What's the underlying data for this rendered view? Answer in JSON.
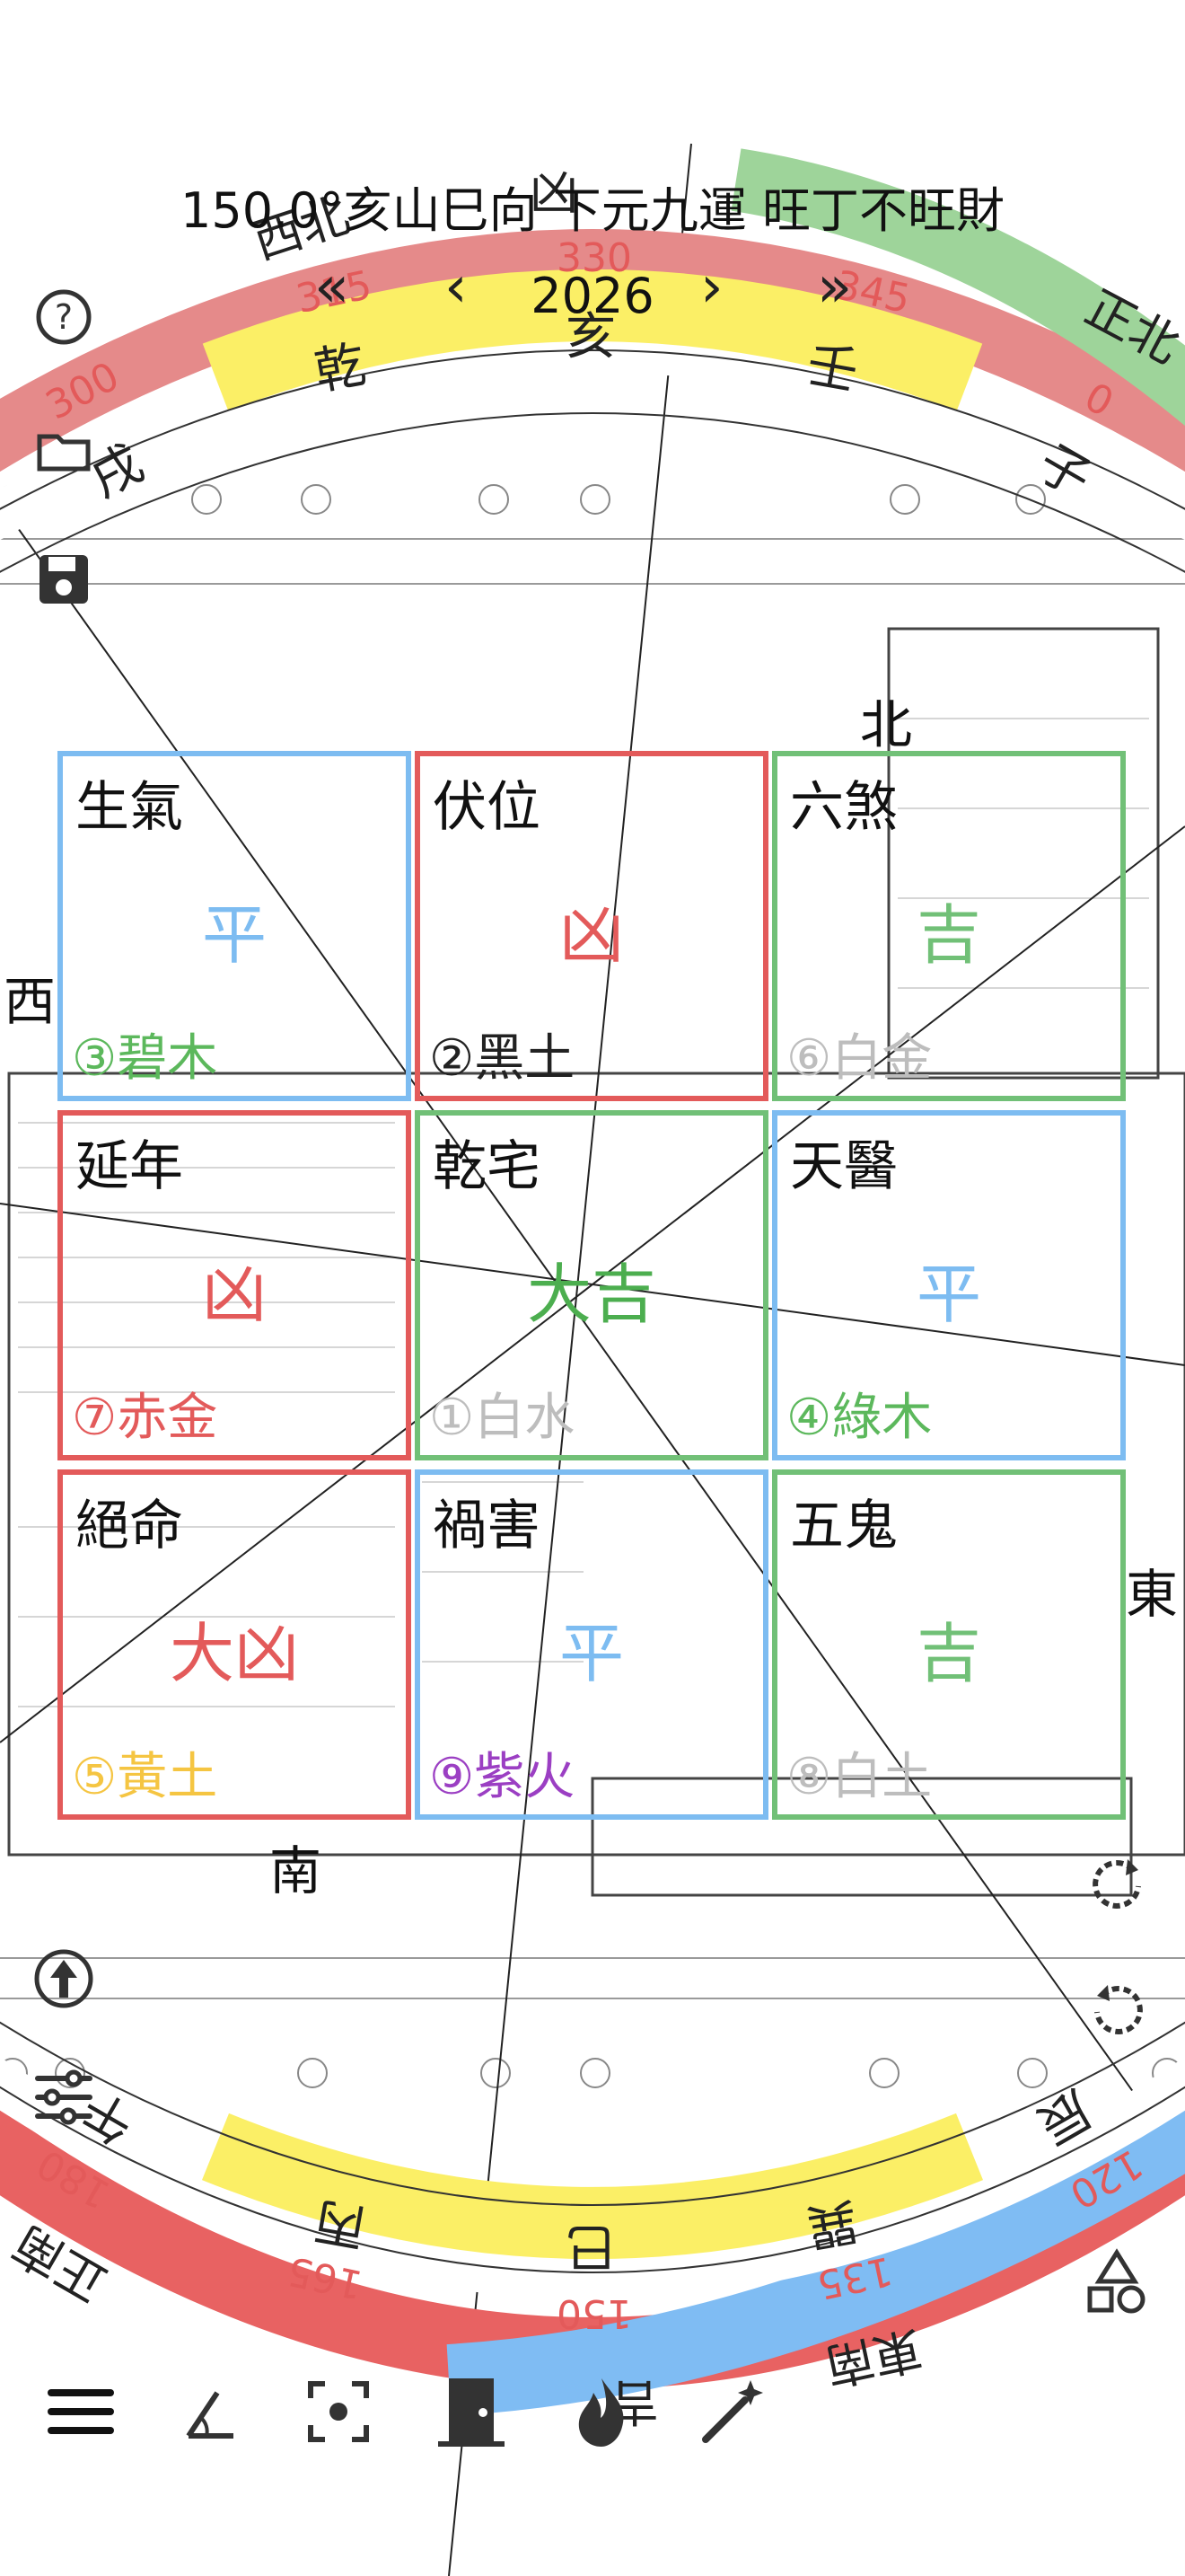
{
  "header": {
    "title": "150.0°亥山巳向 下元九運 旺丁不旺財",
    "year": "2026",
    "nav": {
      "prev_fast": "«",
      "prev": "‹",
      "next": "›",
      "next_fast": "»"
    }
  },
  "compass_top": {
    "mountains_outer": [
      "西北",
      "正北"
    ],
    "degrees": [
      "315",
      "330",
      "345",
      "300",
      "0"
    ],
    "inner": [
      "乾",
      "亥",
      "壬",
      "戌",
      "子"
    ],
    "marker": "凶"
  },
  "compass_bottom": {
    "mountains_outer": [
      "正南",
      "東南"
    ],
    "degrees": [
      "180",
      "165",
      "150",
      "135",
      "120"
    ],
    "inner": [
      "丙",
      "巳",
      "巽",
      "午",
      "辰"
    ],
    "marker": "吉"
  },
  "directions": {
    "north": "北",
    "west": "西",
    "east": "東",
    "south": "南"
  },
  "grid": [
    {
      "name": "生氣",
      "rating": "平",
      "star": "③碧木",
      "star_color": "#5cb85c",
      "rating_color": "#7dbcf1",
      "border": "blue"
    },
    {
      "name": "伏位",
      "rating": "凶",
      "star": "②黑土",
      "star_color": "#222222",
      "rating_color": "#e35a5a",
      "border": "red"
    },
    {
      "name": "六煞",
      "rating": "吉",
      "star": "⑥白金",
      "star_color": "#bdbdbd",
      "rating_color": "#71c077",
      "border": "green"
    },
    {
      "name": "延年",
      "rating": "凶",
      "star": "⑦赤金",
      "star_color": "#e35a5a",
      "rating_color": "#e35a5a",
      "border": "red"
    },
    {
      "name": "乾宅",
      "rating": "大吉",
      "star": "①白水",
      "star_color": "#bdbdbd",
      "rating_color": "#4cae4f",
      "border": "green"
    },
    {
      "name": "天醫",
      "rating": "平",
      "star": "④綠木",
      "star_color": "#5cb85c",
      "rating_color": "#7dbcf1",
      "border": "blue"
    },
    {
      "name": "絕命",
      "rating": "大凶",
      "star": "⑤黃土",
      "star_color": "#f5c542",
      "rating_color": "#e35a5a",
      "border": "red"
    },
    {
      "name": "禍害",
      "rating": "平",
      "star": "⑨紫火",
      "star_color": "#9b3fc3",
      "rating_color": "#7dbcf1",
      "border": "blue"
    },
    {
      "name": "五鬼",
      "rating": "吉",
      "star": "⑧白土",
      "star_color": "#bdbdbd",
      "rating_color": "#71c077",
      "border": "green"
    }
  ],
  "colors": {
    "ring_red": "#e58a8a",
    "ring_green": "#9ed49a",
    "ring_blue": "#7fbcf3",
    "ring_yellow": "#fbef66",
    "ring_red_bottom": "#e86262",
    "degree_text": "#e35a5a"
  },
  "side_icons": [
    "help-icon",
    "folder-icon",
    "save-icon",
    "north-arrow-icon",
    "sliders-icon"
  ],
  "right_icons": [
    "rotate-cw-icon",
    "rotate-ccw-icon",
    "shapes-icon"
  ],
  "toolbar": [
    "menu-icon",
    "angle-icon",
    "focus-icon",
    "door-icon",
    "fire-icon",
    "magic-wand-icon"
  ]
}
